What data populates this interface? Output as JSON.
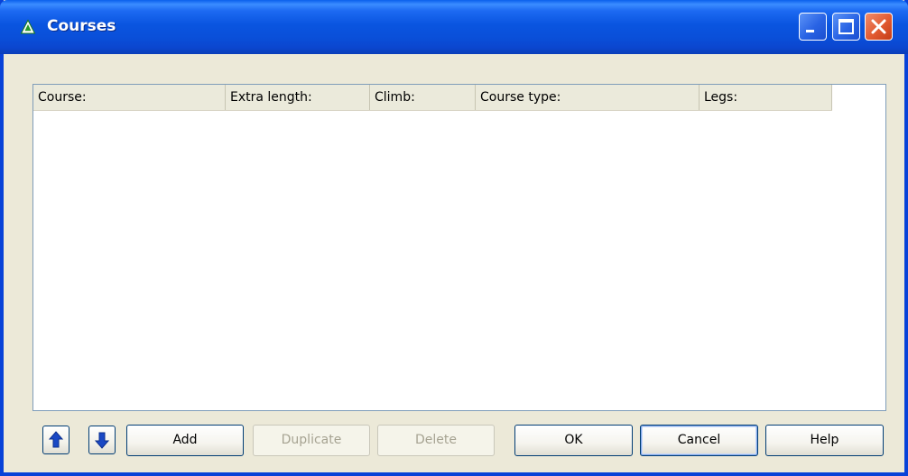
{
  "window": {
    "title": "Courses",
    "app_icon": "orienteering-app-icon",
    "controls": [
      "minimize-icon",
      "maximize-icon",
      "close-icon"
    ]
  },
  "list": {
    "columns": [
      {
        "label": "Course:"
      },
      {
        "label": "Extra length:"
      },
      {
        "label": "Climb:"
      },
      {
        "label": "Course type:"
      },
      {
        "label": "Legs:"
      }
    ],
    "rows": []
  },
  "buttons": {
    "move_up_icon": "arrow-up-icon",
    "move_down_icon": "arrow-down-icon",
    "add": {
      "label": "Add",
      "enabled": true
    },
    "duplicate": {
      "label": "Duplicate",
      "enabled": false
    },
    "delete": {
      "label": "Delete",
      "enabled": false
    },
    "ok": {
      "label": "OK",
      "enabled": true
    },
    "cancel": {
      "label": "Cancel",
      "enabled": true
    },
    "help": {
      "label": "Help",
      "enabled": true
    }
  },
  "colors": {
    "titlebar": "#0a55e0",
    "window_bg": "#ece9d8",
    "arrow": "#1a48c4"
  }
}
